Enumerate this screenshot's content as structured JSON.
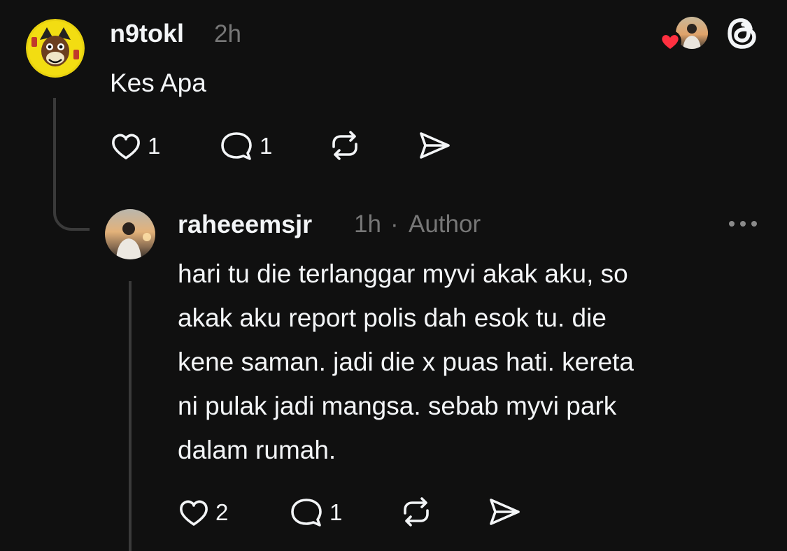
{
  "first_post": {
    "username": "n9tokl",
    "time": "2h",
    "text": "Kes Apa",
    "likes": "1",
    "replies": "1",
    "avatar_icon": "avatar-cartoon-icon"
  },
  "header_right": {
    "liked_by_icon": "heart-badge-icon",
    "app_icon": "threads-logo-icon"
  },
  "reply_post": {
    "username": "raheeemsjr",
    "time": "1h",
    "separator": "·",
    "badge": "Author",
    "text_lines": [
      "hari tu die terlanggar myvi akak aku, so",
      "akak aku report polis dah esok tu. die",
      "kene saman. jadi die x puas hati. kereta",
      "ni pulak jadi mangsa. sebab myvi park",
      "dalam rumah."
    ],
    "likes": "2",
    "replies": "1",
    "avatar_icon": "avatar-photo-icon"
  },
  "colors": {
    "background": "#101010",
    "text": "#f3f5f7",
    "muted": "#777777",
    "heart": "#ff3040",
    "thread_line": "#3a3a3a"
  }
}
